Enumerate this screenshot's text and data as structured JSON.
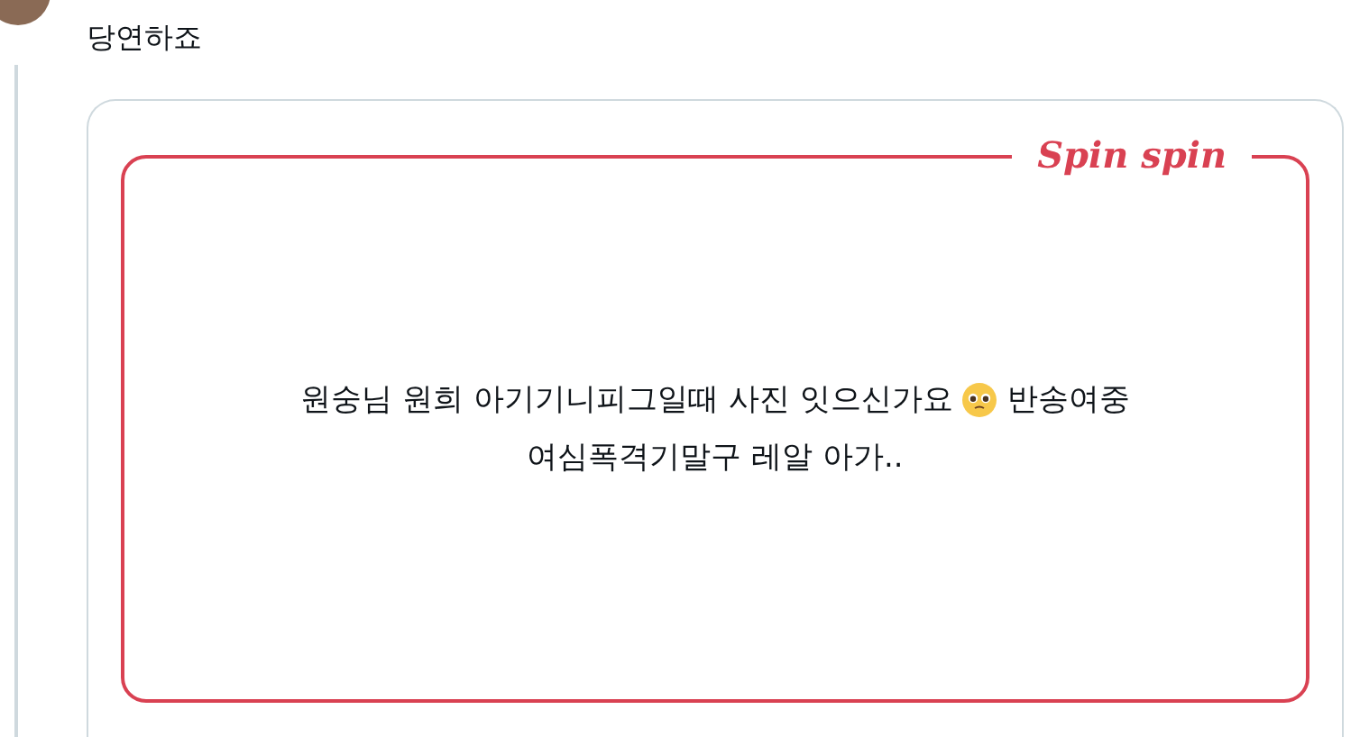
{
  "reply": {
    "text": "당연하죠"
  },
  "card": {
    "logo": "Spin spin",
    "message": {
      "line_1_before_emoji": "원숭님 원희 아기기니피그일때 사진 잇으신가요",
      "line_1_after_emoji": "반송여중",
      "line_2": "여심폭격기말구 레알 아가.."
    }
  }
}
